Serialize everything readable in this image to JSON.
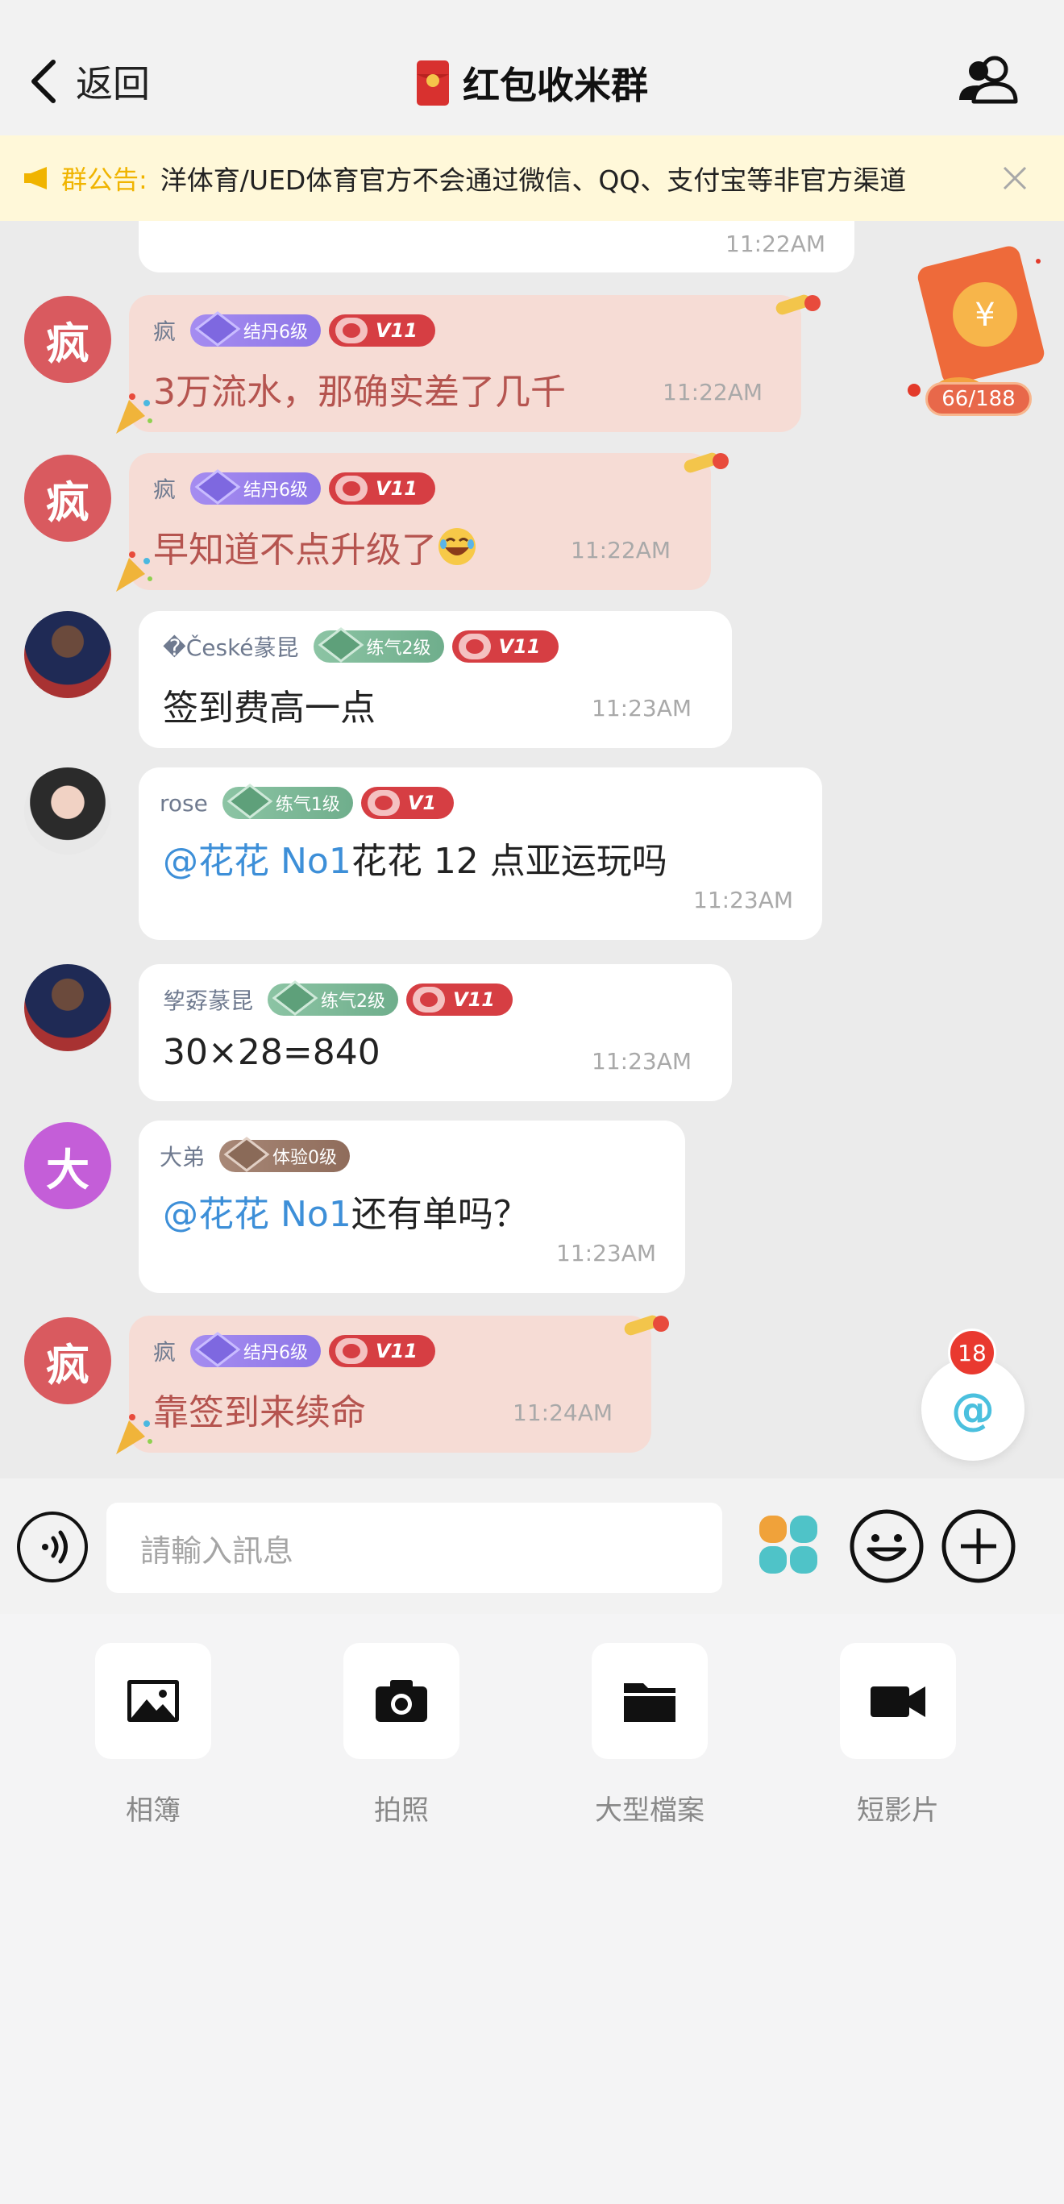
{
  "header": {
    "back_label": "返回",
    "title": "红包收米群"
  },
  "notice": {
    "label": "群公告:",
    "text": "洋体育/UED体育官方不会通过微信、QQ、支付宝等非官方渠道"
  },
  "red_packet": {
    "count": "66/188"
  },
  "messages": [
    {
      "time": "11:22AM"
    },
    {
      "sender": "疯",
      "avatar_text": "疯",
      "level": "结丹6级",
      "vip": "V11",
      "text": "3万流水，那确实差了几千",
      "time": "11:22AM"
    },
    {
      "sender": "疯",
      "avatar_text": "疯",
      "level": "结丹6级",
      "vip": "V11",
      "text": "早知道不点升级了",
      "time": "11:22AM"
    },
    {
      "sender": "�České蒃昆",
      "level": "练气2级",
      "vip": "V11",
      "text": "签到费高一点",
      "time": "11:23AM"
    },
    {
      "sender": "rose",
      "level": "练气1级",
      "vip": "V1",
      "mention": "@花花 No1",
      "text": "花花 12 点亚运玩吗",
      "time": "11:23AM"
    },
    {
      "sender": "孧孬蒃昆",
      "level": "练气2级",
      "vip": "V11",
      "text": "30×28=840",
      "time": "11:23AM"
    },
    {
      "sender": "大弟",
      "avatar_text": "大",
      "level": "体验0级",
      "mention": "@花花 No1",
      "text": "还有单吗？",
      "time": "11:23AM"
    },
    {
      "sender": "疯",
      "avatar_text": "疯",
      "level": "结丹6级",
      "vip": "V11",
      "text": "靠签到来续命",
      "time": "11:24AM"
    }
  ],
  "at_button": {
    "symbol": "@",
    "badge": "18"
  },
  "input": {
    "placeholder": "請輸入訊息"
  },
  "attachments": [
    {
      "label": "相簿",
      "icon": "photo-album-icon"
    },
    {
      "label": "拍照",
      "icon": "camera-icon"
    },
    {
      "label": "大型檔案",
      "icon": "folder-icon"
    },
    {
      "label": "短影片",
      "icon": "video-camera-icon"
    }
  ],
  "colors": {
    "notice_bg": "#fff8d9",
    "notice_label": "#f0b400",
    "pink_bubble": "#f6dcd5",
    "pink_text": "#b5544f",
    "mention": "#3d8fd8",
    "vip": "#d63e43"
  }
}
